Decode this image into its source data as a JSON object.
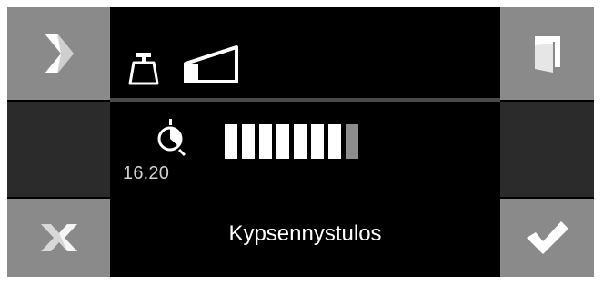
{
  "buttons": {
    "next": {
      "icon": "chevron-right-icon"
    },
    "door": {
      "icon": "door-icon"
    },
    "cancel": {
      "icon": "close-x-icon"
    },
    "confirm": {
      "icon": "checkmark-icon"
    }
  },
  "header": {
    "icons": [
      "weight-icon",
      "wedge-shape-icon"
    ]
  },
  "progress": {
    "icon": "timer-icon",
    "time": "16.20",
    "segments_total": 8,
    "segments_filled": 7.5
  },
  "footer": {
    "label": "Kypsennystulos"
  },
  "colors": {
    "background": "#000000",
    "button_gray": "#8a8a8a",
    "button_dark": "#2b2b2b",
    "text": "#ffffff"
  }
}
